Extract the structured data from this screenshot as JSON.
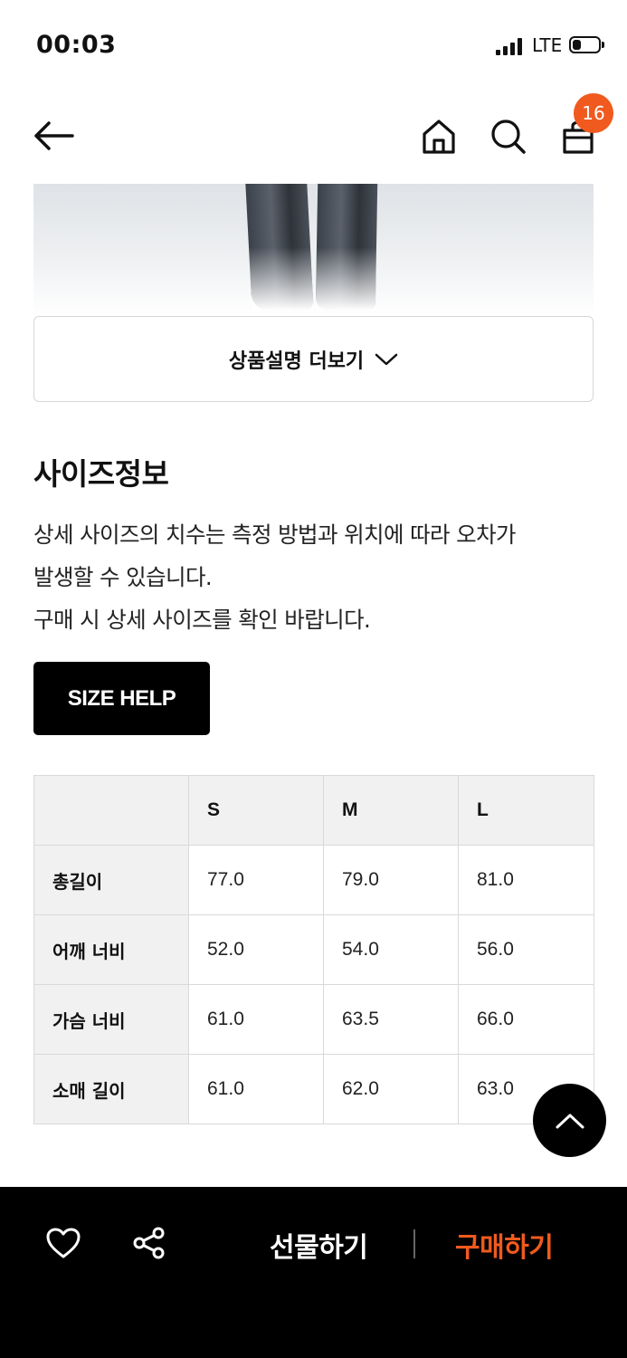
{
  "status_bar": {
    "time": "00:03",
    "network": "LTE"
  },
  "header": {
    "icons": {
      "back": "arrow-left-icon",
      "home": "home-icon",
      "search": "search-icon",
      "bag": "shopping-bag-icon"
    },
    "cart_count": "16"
  },
  "product": {
    "more_label": "상품설명 더보기"
  },
  "size_info": {
    "title": "사이즈정보",
    "description_lines": [
      "상세 사이즈의 치수는 측정 방법과 위치에 따라 오차가",
      "발생할 수 있습니다.",
      "구매 시 상세 사이즈를 확인 바랍니다."
    ],
    "help_button": "SIZE HELP",
    "table": {
      "columns": [
        "",
        "S",
        "M",
        "L"
      ],
      "rows": [
        {
          "label": "총길이",
          "values": [
            "77.0",
            "79.0",
            "81.0"
          ]
        },
        {
          "label": "어깨 너비",
          "values": [
            "52.0",
            "54.0",
            "56.0"
          ]
        },
        {
          "label": "가슴 너비",
          "values": [
            "61.0",
            "63.5",
            "66.0"
          ]
        },
        {
          "label": "소매 길이",
          "values": [
            "61.0",
            "62.0",
            "63.0"
          ]
        }
      ]
    }
  },
  "bottom_bar": {
    "gift_label": "선물하기",
    "buy_label": "구매하기",
    "buy_color": "#f05a1e"
  },
  "colors": {
    "accent": "#f05a1e",
    "button_dark": "#000000",
    "table_header_bg": "#f1f1f1"
  }
}
